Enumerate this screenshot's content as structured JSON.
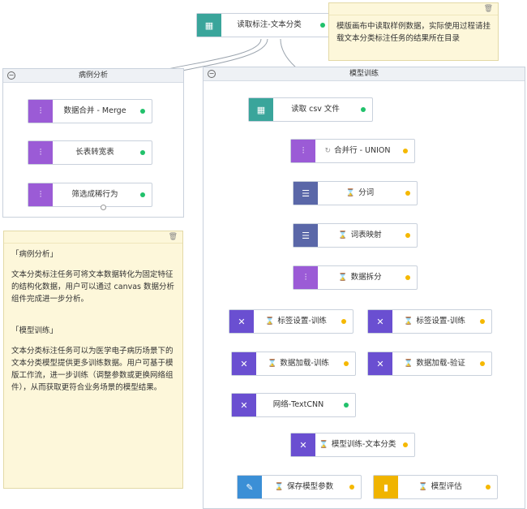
{
  "nodes": {
    "read_anno": {
      "label": "读取标注-文本分类",
      "icon": "table-icon",
      "color": "#3aa59b",
      "status": "green"
    },
    "merge": {
      "label": "数据合并 - Merge",
      "icon": "sliders-icon",
      "color": "#9b5bd6",
      "status": "green"
    },
    "long_wide": {
      "label": "长表转宽表",
      "icon": "sliders-icon",
      "color": "#9b5bd6",
      "status": "green"
    },
    "filter": {
      "label": "筛选成稀行为",
      "icon": "sliders-icon",
      "color": "#9b5bd6",
      "status": "green"
    },
    "read_csv": {
      "label": "读取 csv 文件",
      "icon": "table-icon",
      "color": "#3aa59b",
      "status": "green"
    },
    "union": {
      "label": "合并行 - UNION",
      "icon": "sliders-icon",
      "color": "#9b5bd6",
      "status": "yellow"
    },
    "split_word": {
      "label": "分词",
      "icon": "text-icon",
      "color": "#5a67a8",
      "status": "yellow"
    },
    "vocab_map": {
      "label": "词表映射",
      "icon": "text-icon",
      "color": "#5a67a8",
      "status": "yellow"
    },
    "data_split": {
      "label": "数据拆分",
      "icon": "sliders-icon",
      "color": "#9b5bd6",
      "status": "yellow"
    },
    "label_train": {
      "label": "标签设置-训练",
      "icon": "network-icon",
      "color": "#6a4fd1",
      "status": "yellow"
    },
    "label_val": {
      "label": "标签设置-训练",
      "icon": "network-icon",
      "color": "#6a4fd1",
      "status": "yellow"
    },
    "load_train": {
      "label": "数据加载-训练",
      "icon": "network-icon",
      "color": "#6a4fd1",
      "status": "yellow"
    },
    "load_val": {
      "label": "数据加载-验证",
      "icon": "network-icon",
      "color": "#6a4fd1",
      "status": "yellow"
    },
    "textcnn": {
      "label": "网络-TextCNN",
      "icon": "network-icon",
      "color": "#6a4fd1",
      "status": "green"
    },
    "train": {
      "label": "模型训练-文本分类",
      "icon": "network-icon",
      "color": "#6a4fd1",
      "status": "yellow"
    },
    "save": {
      "label": "保存模型参数",
      "icon": "save-icon",
      "color": "#3b8fd6",
      "status": "yellow"
    },
    "eval": {
      "label": "模型评估",
      "icon": "chart-icon",
      "color": "#f0b400",
      "status": "yellow"
    }
  },
  "groups": {
    "case_analysis": {
      "title": "病例分析"
    },
    "model_training": {
      "title": "模型训练"
    }
  },
  "notes": {
    "top": {
      "text": "模版画布中读取样例数据，实际使用过程请挂载文本分类标注任务的结果所在目录"
    },
    "left": {
      "h1": "「病例分析」",
      "p1": "文本分类标注任务可将文本数据转化为固定特征的结构化数据，用户可以通过 canvas 数据分析组件完成进一步分析。",
      "h2": "「模型训练」",
      "p2": "文本分类标注任务可以为医学电子病历场景下的文本分类模型提供更多训练数据。用户可基于模版工作流，进一步训练（调整参数或更换网络组件），从而获取更符合业务场景的模型结果。"
    }
  },
  "colors": {
    "edge": "#9aa3ad",
    "green": "#21c16b",
    "yellow": "#f5b800"
  }
}
